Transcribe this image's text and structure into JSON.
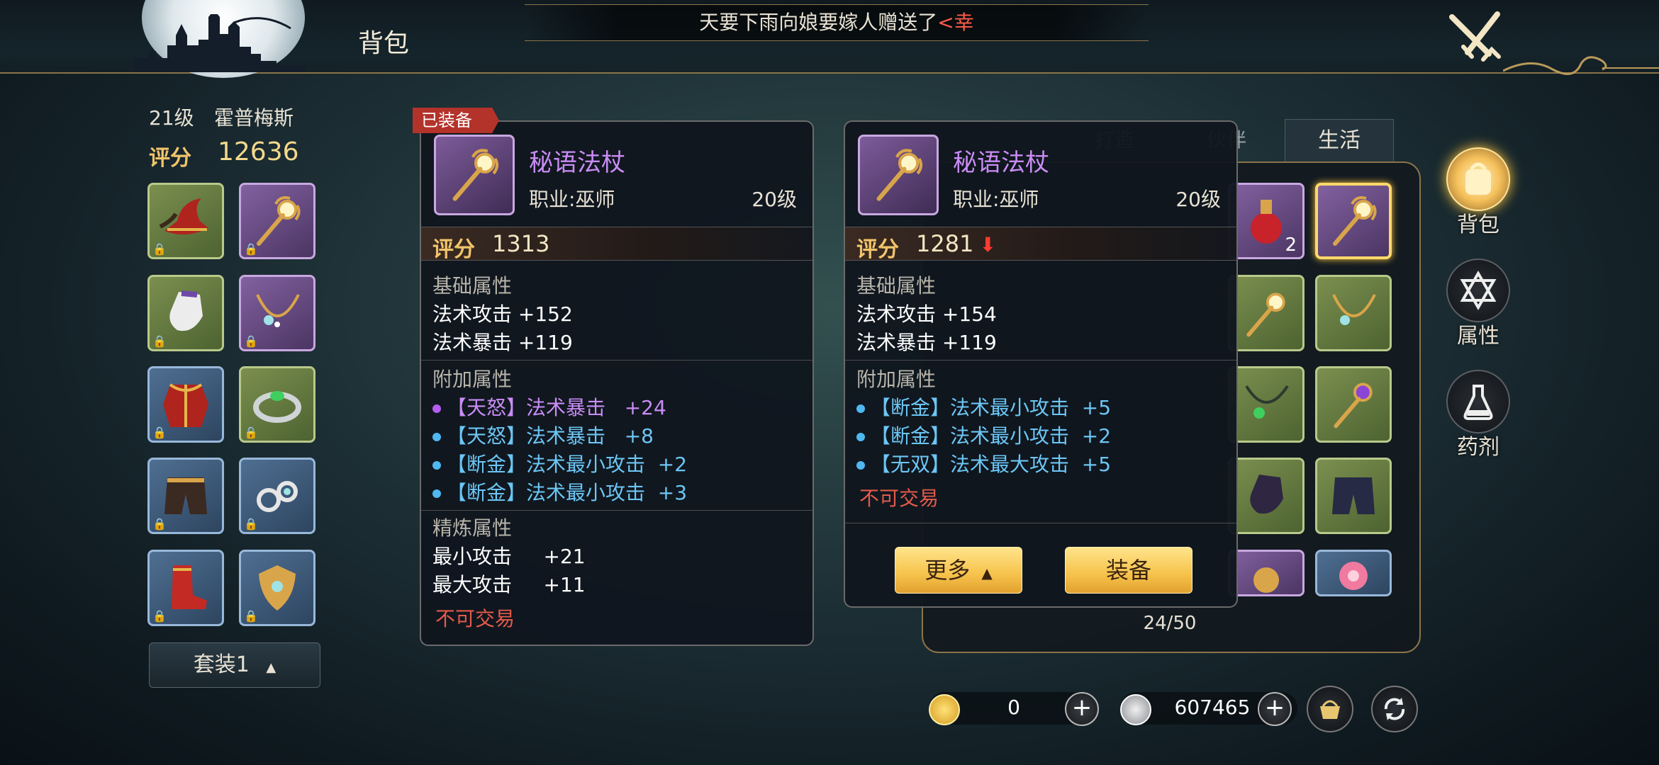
{
  "header": {
    "title": "背包",
    "marquee_text": "天要下雨向娘要嫁人赠送了",
    "marquee_highlight": "<幸"
  },
  "character": {
    "level": "21级",
    "name": "霍普梅斯",
    "score_label": "评分",
    "score_value": "12636",
    "suit_label": "套装1"
  },
  "equipped_item": {
    "tag": "已装备",
    "name": "秘语法杖",
    "job": "职业:巫师",
    "level": "20级",
    "score_label": "评分",
    "score_value": "1313",
    "base_title": "基础属性",
    "base_stats": [
      "法术攻击 +152",
      "法术暴击 +119"
    ],
    "extra_title": "附加属性",
    "extra_stats": [
      {
        "text": "【天怒】法术暴击   +24",
        "color": "#b45cf0"
      },
      {
        "text": "【天怒】法术暴击   +8",
        "color": "#4fb8f0"
      },
      {
        "text": "【断金】法术最小攻击  +2",
        "color": "#4fb8f0"
      },
      {
        "text": "【断金】法术最小攻击  +3",
        "color": "#4fb8f0"
      }
    ],
    "refine_title": "精炼属性",
    "refine_stats": [
      "最小攻击     +21",
      "最大攻击     +11"
    ],
    "untradeable": "不可交易"
  },
  "compare_item": {
    "name": "秘语法杖",
    "job": "职业:巫师",
    "level": "20级",
    "score_label": "评分",
    "score_value": "1281",
    "base_title": "基础属性",
    "base_stats": [
      "法术攻击 +154",
      "法术暴击 +119"
    ],
    "extra_title": "附加属性",
    "extra_stats": [
      {
        "text": "【断金】法术最小攻击  +5",
        "color": "#4fb8f0"
      },
      {
        "text": "【断金】法术最小攻击  +2",
        "color": "#4fb8f0"
      },
      {
        "text": "【无双】法术最大攻击  +5",
        "color": "#4fb8f0"
      }
    ],
    "untradeable": "不可交易",
    "more_button": "更多",
    "equip_button": "装备"
  },
  "bag": {
    "tabs": [
      "打造",
      "伙伴",
      "生活"
    ],
    "capacity": "24/50",
    "potion_qty": "2"
  },
  "side_nav": [
    {
      "label": "背包",
      "icon": "backpack-icon"
    },
    {
      "label": "属性",
      "icon": "hexagram-icon"
    },
    {
      "label": "药剂",
      "icon": "potion-flask-icon"
    }
  ],
  "currency": {
    "gold_value": "0",
    "silver_value": "607465"
  },
  "colors": {
    "accent_gold": "#f4c65a",
    "item_name_purple": "#c98cf5",
    "untradeable_red": "#e45a4a",
    "down_arrow_red": "#ff3b30"
  }
}
